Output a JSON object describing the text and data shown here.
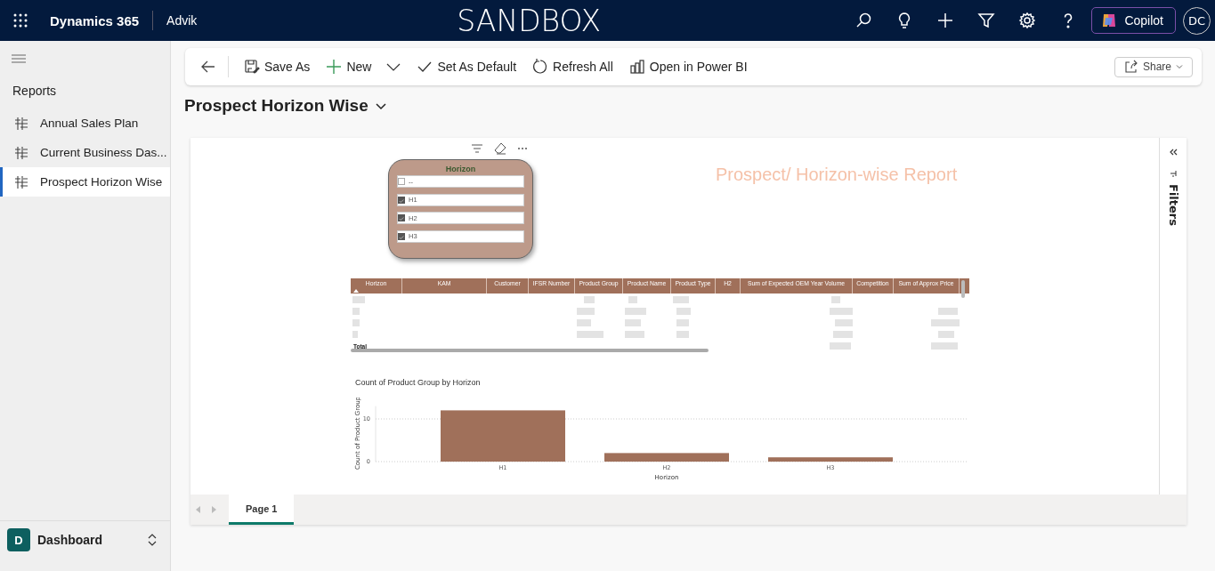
{
  "header": {
    "app_name": "Dynamics 365",
    "org": "Advik",
    "environment": "SANDBOX",
    "copilot": "Copilot",
    "avatar_initials": "DC"
  },
  "sidebar": {
    "heading": "Reports",
    "items": [
      {
        "label": "Annual Sales Plan",
        "selected": false
      },
      {
        "label": "Current Business Das...",
        "selected": false
      },
      {
        "label": "Prospect Horizon Wise",
        "selected": true
      }
    ],
    "area": {
      "initial": "D",
      "label": "Dashboard"
    }
  },
  "toolbar": {
    "items": [
      {
        "kind": "save",
        "label": "Save As"
      },
      {
        "kind": "new",
        "label": "New"
      },
      {
        "kind": "default",
        "label": "Set As Default"
      },
      {
        "kind": "refresh",
        "label": "Refresh All"
      },
      {
        "kind": "powerbi",
        "label": "Open in Power BI"
      }
    ],
    "share": "Share"
  },
  "report_selector": {
    "title": "Prospect Horizon Wise"
  },
  "report": {
    "title": "Prospect/ Horizon-wise Report",
    "slicer": {
      "title": "Horizon",
      "options": [
        {
          "label": "--",
          "checked": false
        },
        {
          "label": "H1",
          "checked": true
        },
        {
          "label": "H2",
          "checked": true
        },
        {
          "label": "H3",
          "checked": true
        }
      ]
    },
    "table": {
      "columns": [
        "Horizon",
        "KAM",
        "Customer",
        "IFSR Number",
        "Product Group",
        "Product Name",
        "Product Type",
        "H2",
        "Sum of Expected OEM Year Volume",
        "Competition",
        "Sum of Approx Price"
      ],
      "total_label": "Total"
    },
    "chart": {
      "chart_data": {
        "type": "bar",
        "title": "Count of Product Group by Horizon",
        "xlabel": "Horizon",
        "ylabel": "Count of Product Group",
        "categories": [
          "H1",
          "H2",
          "H3"
        ],
        "series": [
          {
            "color": "#a0705a",
            "values": [
              12,
              2,
              1
            ]
          }
        ],
        "ylim": [
          0,
          13
        ],
        "yticks": [
          0,
          10
        ]
      }
    },
    "filters_label": "Filters",
    "pages": [
      {
        "label": "Page 1",
        "selected": true
      }
    ]
  }
}
